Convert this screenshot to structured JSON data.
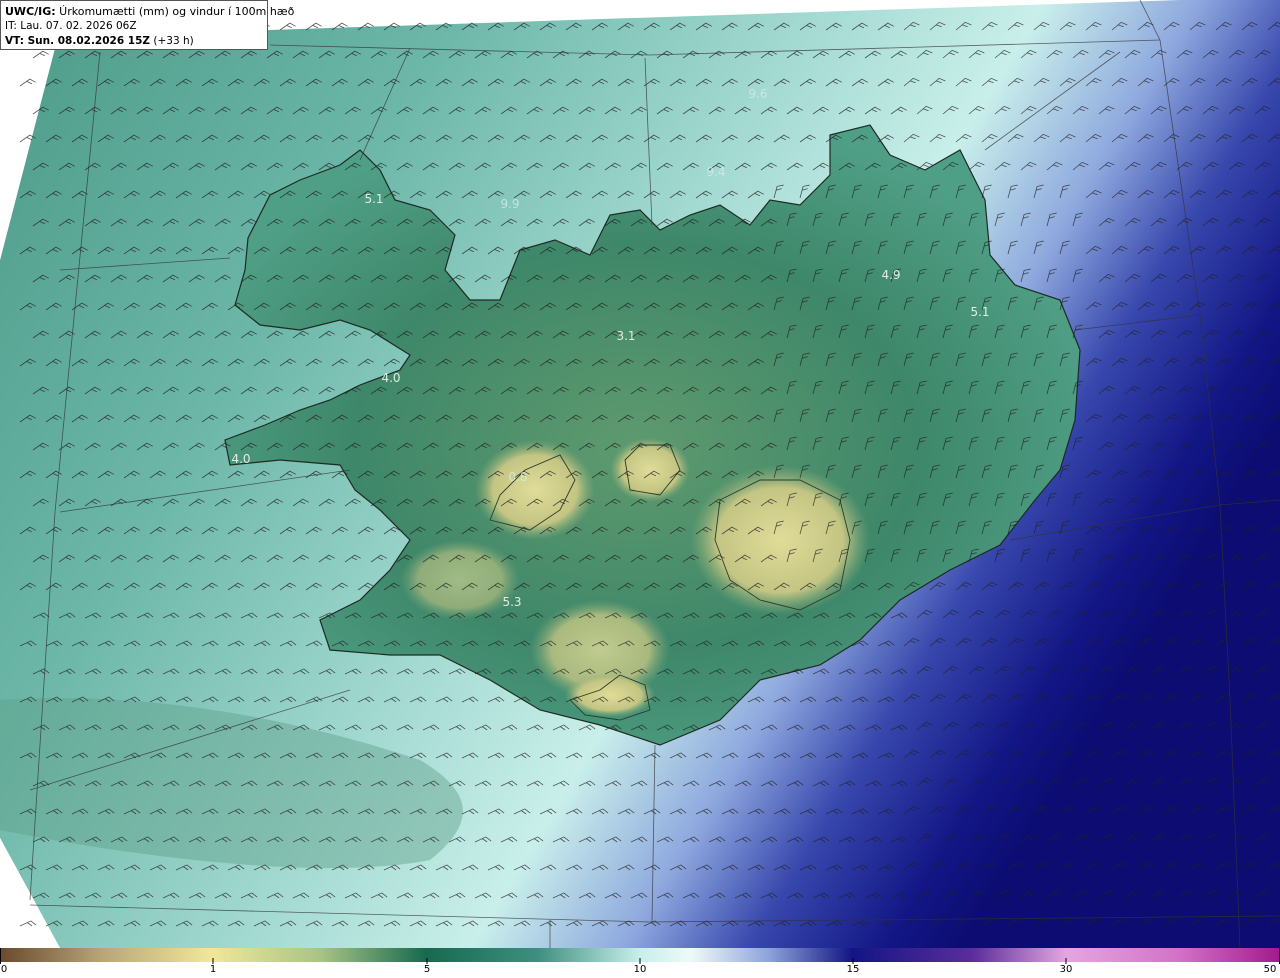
{
  "header": {
    "title_prefix": "UWC/IG:",
    "title_text": " Úrkomumætti (mm) og vindur í 100m hæð",
    "issue_time": "IT: Lau. 07. 02. 2026 06Z",
    "valid_prefix": "VT: Sun. 08.02.2026 15Z",
    "valid_offset": " (+33 h)"
  },
  "colorbar": {
    "ticks": [
      "0",
      "1",
      "5",
      "10",
      "15",
      "30",
      "50"
    ],
    "colors": [
      "#7a5a3c",
      "#c6b98a",
      "#efe79c",
      "#b9cd8a",
      "#2f7a5a",
      "#0e5a48",
      "#6dc0b4",
      "#c8f0ec",
      "#ffffff",
      "#9db4e0",
      "#3f55b5",
      "#1a1e8a",
      "#10107a",
      "#5a2a9a",
      "#c46ac8",
      "#e8a8e0",
      "#b0209a"
    ]
  },
  "values": [
    {
      "text": "5.1",
      "faded": false
    },
    {
      "text": "9.9",
      "faded": true
    },
    {
      "text": "9.6",
      "faded": true
    },
    {
      "text": "9.4",
      "faded": true
    },
    {
      "text": "3.1",
      "faded": false
    },
    {
      "text": "4.9",
      "faded": false
    },
    {
      "text": "5.1",
      "faded": false
    },
    {
      "text": "4.0",
      "faded": false
    },
    {
      "text": "4.0",
      "faded": false
    },
    {
      "text": "0.8",
      "faded": true
    },
    {
      "text": "5.3",
      "faded": false
    }
  ],
  "colors": {
    "sea_green": "#5fae9e",
    "land_green": "#3c8a6a",
    "highland_yellow": "#d6d38f",
    "east_blue": "#1a2a9a",
    "barb": "#222222"
  }
}
